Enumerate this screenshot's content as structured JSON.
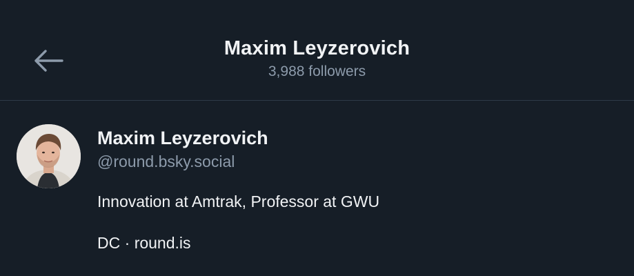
{
  "header": {
    "title": "Maxim Leyzerovich",
    "subtitle": "3,988 followers",
    "back_icon": "arrow-left-icon"
  },
  "profile": {
    "name": "Maxim Leyzerovich",
    "handle": "@round.bsky.social",
    "bio": "Innovation at Amtrak, Professor at GWU",
    "location": "DC",
    "separator": " · ",
    "website": "round.is"
  },
  "colors": {
    "background": "#161e27",
    "primary_text": "#f1f3f5",
    "secondary_text": "#8d9bab",
    "divider": "#2e3a48"
  }
}
